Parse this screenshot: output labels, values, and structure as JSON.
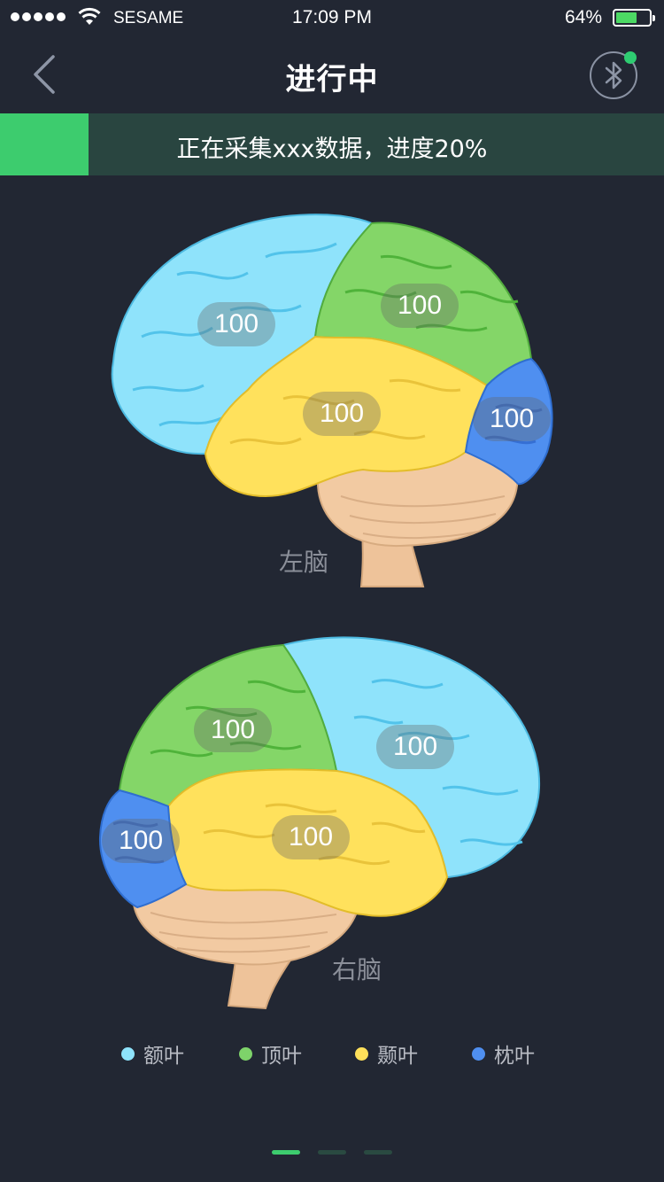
{
  "status_bar": {
    "carrier": "SESAME",
    "time": "17:09 PM",
    "battery_percent": "64%",
    "battery_level": 0.64
  },
  "nav": {
    "title": "进行中",
    "back_icon": "chevron-left-icon",
    "bluetooth_icon": "bluetooth-icon",
    "bluetooth_connected": true
  },
  "progress": {
    "text": "正在采集xxx数据，进度20%",
    "value": 0.2,
    "color": "#3dcc6e"
  },
  "left_brain": {
    "label": "左脑",
    "frontal": "100",
    "parietal": "100",
    "temporal": "100",
    "occipital": "100"
  },
  "right_brain": {
    "label": "右脑",
    "frontal": "100",
    "parietal": "100",
    "temporal": "100",
    "occipital": "100"
  },
  "legend": [
    {
      "label": "额叶",
      "color": "#8ee3fb"
    },
    {
      "label": "顶叶",
      "color": "#7ed36a"
    },
    {
      "label": "颞叶",
      "color": "#ffe05a"
    },
    {
      "label": "枕叶",
      "color": "#4f8ff0"
    }
  ],
  "pager": {
    "pages": 3,
    "active": 0
  }
}
